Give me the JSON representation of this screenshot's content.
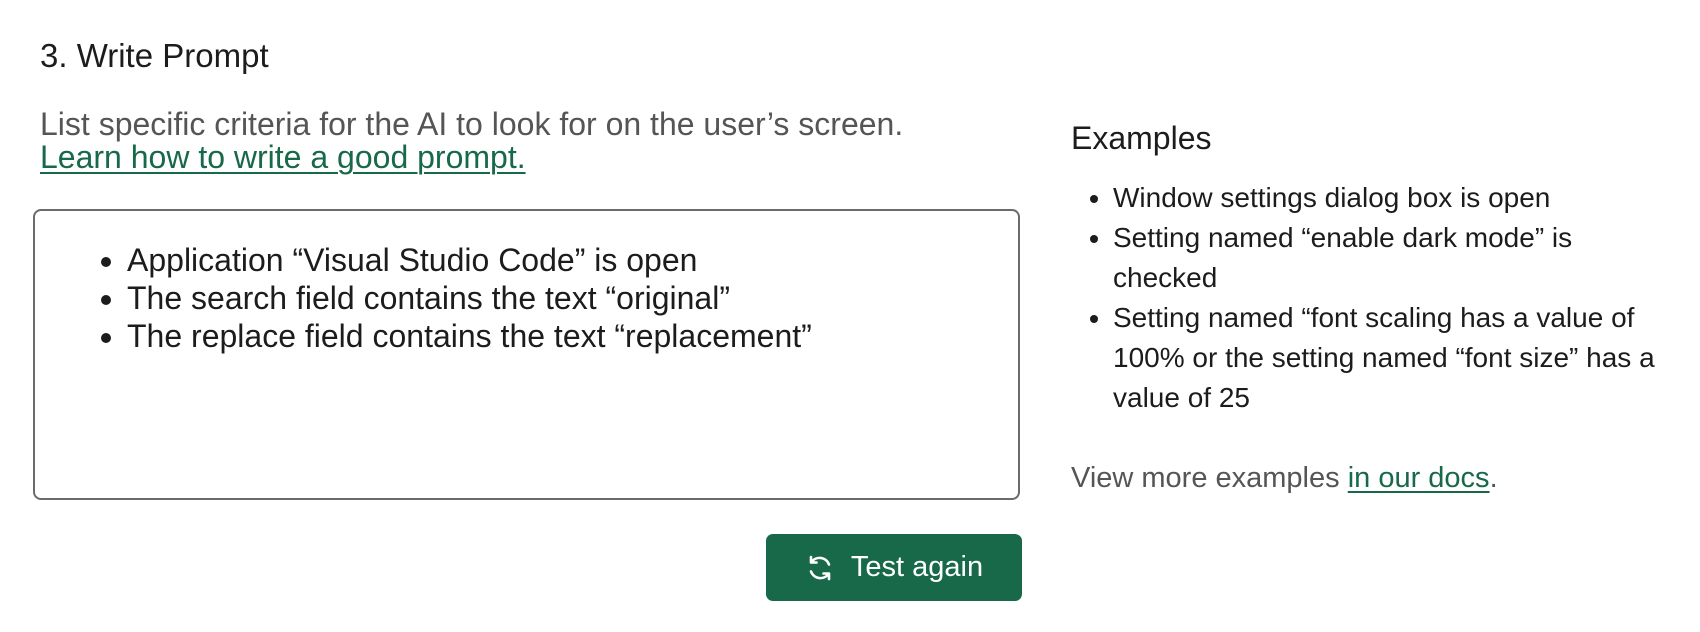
{
  "section": {
    "title": "3. Write Prompt",
    "intro_text": "List specific criteria for the AI to look for on the user’s screen.",
    "intro_link": "Learn how to write a good prompt."
  },
  "prompt": {
    "items": [
      "Application “Visual Studio Code” is open",
      "The search field contains the text “original”",
      "The replace field contains the text “replacement”"
    ]
  },
  "actions": {
    "test_again_label": "Test again",
    "test_again_icon": "refresh-icon",
    "accent_color": "#17694a"
  },
  "examples": {
    "title": "Examples",
    "items": [
      "Window settings dialog box is open",
      "Setting named “enable dark mode” is checked",
      "Setting named “font scaling has a value of 100% or the setting named “font size” has a value of 25"
    ],
    "view_more_prefix": "View more examples ",
    "view_more_link": "in our docs",
    "view_more_suffix": "."
  }
}
